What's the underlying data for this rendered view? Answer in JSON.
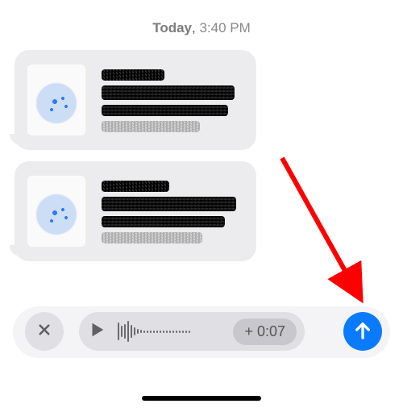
{
  "timestamp": {
    "day": "Today",
    "time": "3:40 PM"
  },
  "recording": {
    "duration_label": "+ 0:07",
    "duration_seconds": 7,
    "waveform_heights": [
      22,
      14,
      18,
      26,
      16,
      10,
      6,
      4,
      3,
      3,
      3,
      3,
      3,
      3,
      3,
      3,
      3,
      3,
      3,
      3,
      3,
      3,
      3
    ],
    "state": "paused"
  },
  "controls": {
    "cancel_icon": "x",
    "play_icon": "play",
    "send_icon": "arrow-up"
  },
  "colors": {
    "send_button": "#0A7BFF",
    "bubble_bg": "#ECECEE",
    "pill_bg": "#E0E0E4"
  },
  "annotation": {
    "arrow_target": "send-button",
    "arrow_color": "#FF0000"
  }
}
